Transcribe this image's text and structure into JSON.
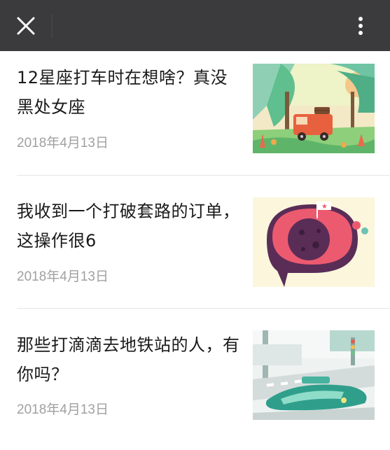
{
  "articles": [
    {
      "title": "12星座打车时在想啥？真没黑处女座",
      "date": "2018年4月13日",
      "thumb": "orange-car-forest-illustration"
    },
    {
      "title": "我收到一个打破套路的订单，这操作很6",
      "date": "2018年4月13日",
      "thumb": "planet-flag-speech-bubble-illustration"
    },
    {
      "title": "那些打滴滴去地铁站的人，有你吗？",
      "date": "2018年4月13日",
      "thumb": "subway-crossing-illustration"
    }
  ],
  "colors": {
    "topbar": "#3b3b3d",
    "title": "#1a1a1a",
    "date": "#a0a0a0",
    "divider": "#e6e6e6"
  }
}
